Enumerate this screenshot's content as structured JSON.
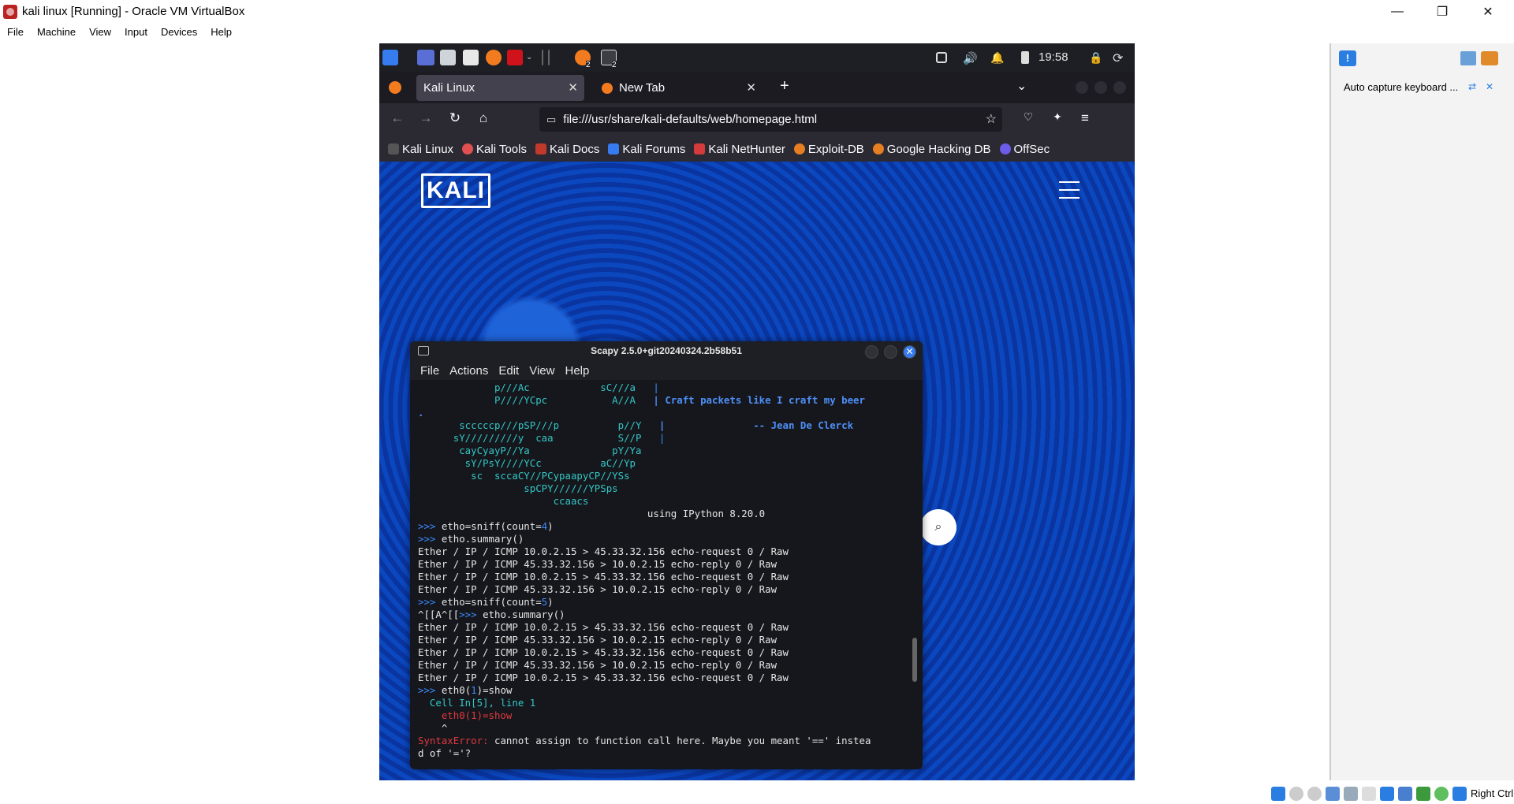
{
  "window": {
    "title": "kali linux [Running] - Oracle VM VirtualBox",
    "controls": [
      "—",
      "❐",
      "✕"
    ]
  },
  "menubar": [
    "File",
    "Machine",
    "View",
    "Input",
    "Devices",
    "Help"
  ],
  "kali_panel": {
    "clock": "19:58",
    "badge_count": "2",
    "badge_count_2": "2"
  },
  "browser": {
    "tabs": [
      {
        "label": "Kali Linux",
        "active": true
      },
      {
        "label": "New Tab",
        "active": false
      }
    ],
    "new_tab": "+",
    "url": "file:///usr/share/kali-defaults/web/homepage.html",
    "bookmarks": [
      "Kali Linux",
      "Kali Tools",
      "Kali Docs",
      "Kali Forums",
      "Kali NetHunter",
      "Exploit-DB",
      "Google Hacking DB",
      "OffSec"
    ]
  },
  "page": {
    "logo": "KALI"
  },
  "terminal": {
    "title": "Scapy 2.5.0+git20240324.2b58b51",
    "menu": [
      "File",
      "Actions",
      "Edit",
      "View",
      "Help"
    ],
    "banner_lines": [
      {
        "art": "             p///Ac            sC///a   ",
        "quote": "|"
      },
      {
        "art": "             P////YCpc           A//A   ",
        "quote": "| Craft packets like I craft my beer"
      },
      {
        "art": ".",
        "quote": ""
      },
      {
        "art": "       scccccp///pSP///p          p//Y   ",
        "quote": "|               -- Jean De Clerck"
      },
      {
        "art": "      sY/////////y  caa           S//P   ",
        "quote": "|"
      },
      {
        "art": "       cayCyayP//Ya              pY/Ya",
        "quote": ""
      },
      {
        "art": "        sY/PsY////YCc          aC//Yp",
        "quote": ""
      },
      {
        "art": "         sc  sccaCY//PCypaapyCP//YSs",
        "quote": ""
      },
      {
        "art": "                  spCPY//////YPSps",
        "quote": ""
      },
      {
        "art": "                       ccaacs",
        "quote": ""
      }
    ],
    "ipython_line": "                                       using IPython 8.20.0",
    "prompt": ">>>",
    "cmd1_pre": "etho=sniff(count=",
    "cmd1_num": "4",
    "cmd1_post": ")",
    "cmd2": "etho.summary()",
    "out1": [
      "Ether / IP / ICMP 10.0.2.15 > 45.33.32.156 echo-request 0 / Raw",
      "Ether / IP / ICMP 45.33.32.156 > 10.0.2.15 echo-reply 0 / Raw",
      "Ether / IP / ICMP 10.0.2.15 > 45.33.32.156 echo-request 0 / Raw",
      "Ether / IP / ICMP 45.33.32.156 > 10.0.2.15 echo-reply 0 / Raw"
    ],
    "cmd3_pre": "etho=sniff(count=",
    "cmd3_num": "5",
    "cmd3_post": ")",
    "esc_prefix": "^[[A^[[",
    "cmd4": "etho.summary()",
    "out2": [
      "Ether / IP / ICMP 10.0.2.15 > 45.33.32.156 echo-request 0 / Raw",
      "Ether / IP / ICMP 45.33.32.156 > 10.0.2.15 echo-reply 0 / Raw",
      "Ether / IP / ICMP 10.0.2.15 > 45.33.32.156 echo-request 0 / Raw",
      "Ether / IP / ICMP 45.33.32.156 > 10.0.2.15 echo-reply 0 / Raw",
      "Ether / IP / ICMP 10.0.2.15 > 45.33.32.156 echo-request 0 / Raw"
    ],
    "cmd5_pre": "eth0(",
    "cmd5_num": "1",
    "cmd5_post": ")=show",
    "tb_cell": "  Cell In[5], line 1",
    "tb_code": "    eth0(1)=show",
    "tb_caret": "    ^",
    "err_name": "SyntaxError:",
    "err_msg": " cannot assign to function call here. Maybe you meant '==' instea",
    "err_msg2": "d of '='?"
  },
  "side_panel": {
    "message": "Auto capture keyboard ..."
  },
  "statusbar": {
    "host_key": "Right Ctrl"
  },
  "colors": {
    "kali_blue": "#367bf0",
    "page_blue": "#0a3aa8",
    "terminal_bg": "#15171c"
  }
}
